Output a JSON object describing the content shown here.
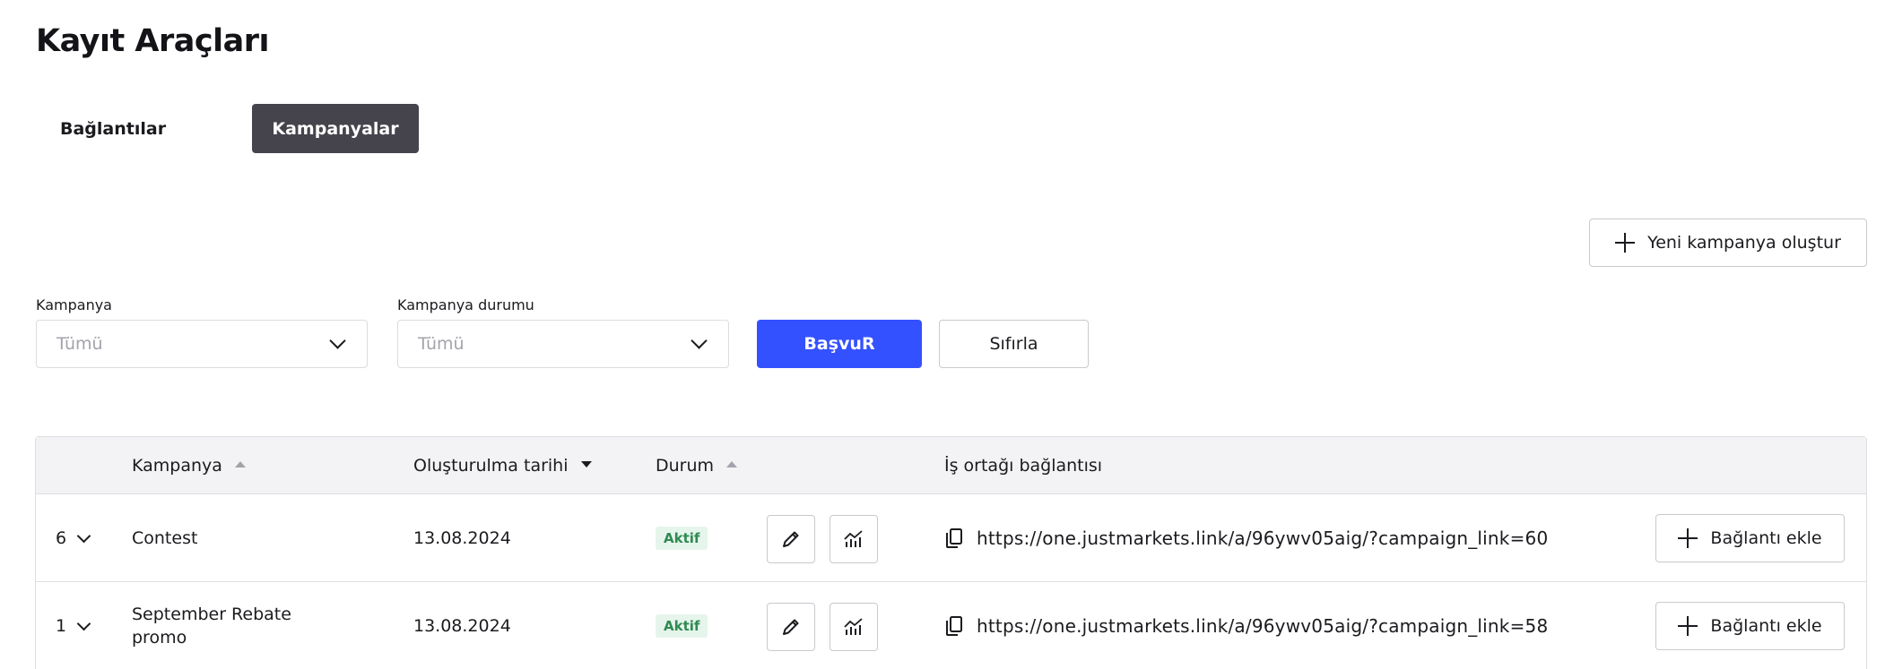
{
  "page": {
    "title": "Kayıt Araçları"
  },
  "tabs": [
    {
      "label": "Bağlantılar",
      "active": false
    },
    {
      "label": "Kampanyalar",
      "active": true
    }
  ],
  "actions": {
    "new_campaign_label": "Yeni kampanya oluştur"
  },
  "filters": {
    "campaign": {
      "label": "Kampanya",
      "value": "Tümü"
    },
    "campaign_status": {
      "label": "Kampanya durumu",
      "value": "Tümü"
    },
    "apply_label": "BaşvuR",
    "reset_label": "Sıfırla"
  },
  "table": {
    "columns": {
      "campaign": "Kampanya",
      "created_date": "Oluşturulma tarihi",
      "status": "Durum",
      "partner_link": "İş ortağı bağlantısı"
    },
    "add_link_label": "Bağlantı ekle",
    "rows": [
      {
        "count": "6",
        "campaign": "Contest",
        "created_date": "13.08.2024",
        "status": "Aktif",
        "link": "https://one.justmarkets.link/a/96ywv05aig/?campaign_link=60"
      },
      {
        "count": "1",
        "campaign": "September Rebate promo",
        "created_date": "13.08.2024",
        "status": "Aktif",
        "link": "https://one.justmarkets.link/a/96ywv05aig/?campaign_link=58"
      }
    ]
  },
  "colors": {
    "primary": "#3451ff",
    "active_tab": "#45444c",
    "badge_bg": "#e6f5ec",
    "badge_text": "#2f8a52",
    "header_bg": "#f3f3f5"
  }
}
